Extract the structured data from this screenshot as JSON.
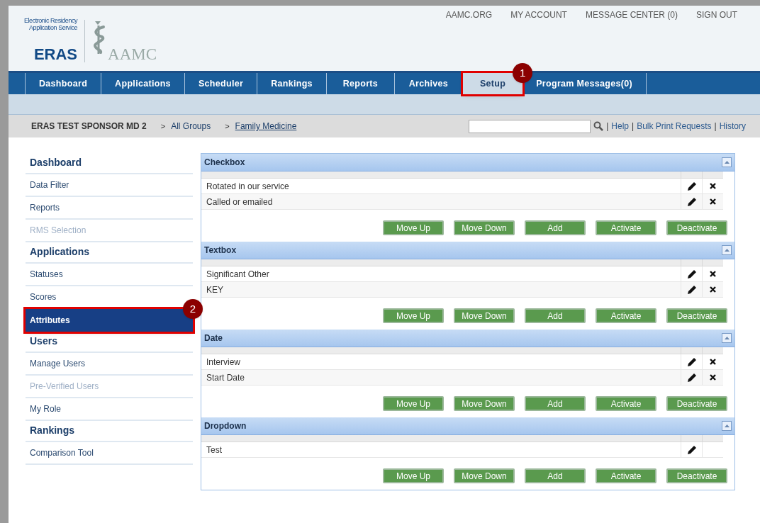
{
  "logo": {
    "tagline_1": "Electronic Residency",
    "tagline_2": "Application Service",
    "wordmark": "ERAS",
    "partner": "AAMC"
  },
  "top_links": [
    "AAMC.ORG",
    "MY ACCOUNT",
    "MESSAGE CENTER (0)",
    "SIGN OUT"
  ],
  "nav_tabs": [
    {
      "label": "Dashboard",
      "selected": false
    },
    {
      "label": "Applications",
      "selected": false
    },
    {
      "label": "Scheduler",
      "selected": false
    },
    {
      "label": "Rankings",
      "selected": false
    },
    {
      "label": "Reports",
      "selected": false
    },
    {
      "label": "Archives",
      "selected": false
    },
    {
      "label": "Setup",
      "selected": true,
      "callout": "1"
    },
    {
      "label": "Program Messages(0)",
      "selected": false
    }
  ],
  "breadcrumb": {
    "sponsor": "ERAS TEST SPONSOR MD 2",
    "crumbs": [
      {
        "arrow": ">",
        "label": "All Groups",
        "underlined": false
      },
      {
        "arrow": ">",
        "label": "Family Medicine",
        "underlined": true
      }
    ]
  },
  "utility": {
    "separator": "|",
    "links": [
      "Help",
      "Bulk Print Requests",
      "History"
    ]
  },
  "sidebar": [
    {
      "heading": "Dashboard",
      "items": [
        {
          "label": "Data Filter",
          "selected": false,
          "disabled": false
        },
        {
          "label": "Reports",
          "selected": false,
          "disabled": false
        },
        {
          "label": "RMS Selection",
          "selected": false,
          "disabled": true
        }
      ]
    },
    {
      "heading": "Applications",
      "items": [
        {
          "label": "Statuses",
          "selected": false,
          "disabled": false
        },
        {
          "label": "Scores",
          "selected": false,
          "disabled": false
        },
        {
          "label": "Attributes",
          "selected": true,
          "disabled": false,
          "callout": "2"
        }
      ]
    },
    {
      "heading": "Users",
      "items": [
        {
          "label": "Manage Users",
          "selected": false,
          "disabled": false
        },
        {
          "label": "Pre-Verified Users",
          "selected": false,
          "disabled": true
        },
        {
          "label": "My Role",
          "selected": false,
          "disabled": false
        }
      ]
    },
    {
      "heading": "Rankings",
      "items": [
        {
          "label": "Comparison Tool",
          "selected": false,
          "disabled": false
        }
      ]
    }
  ],
  "panels": [
    {
      "title": "Checkbox",
      "rows": [
        {
          "name": "Rotated in our service",
          "deletable": true
        },
        {
          "name": "Called or emailed",
          "deletable": true
        }
      ],
      "buttons": [
        "Move Up",
        "Move Down",
        "Add",
        "Activate",
        "Deactivate"
      ]
    },
    {
      "title": "Textbox",
      "rows": [
        {
          "name": "Significant Other",
          "deletable": true
        },
        {
          "name": "KEY",
          "deletable": true
        }
      ],
      "buttons": [
        "Move Up",
        "Move Down",
        "Add",
        "Activate",
        "Deactivate"
      ]
    },
    {
      "title": "Date",
      "rows": [
        {
          "name": "Interview",
          "deletable": true
        },
        {
          "name": "Start Date",
          "deletable": true
        }
      ],
      "buttons": [
        "Move Up",
        "Move Down",
        "Add",
        "Activate",
        "Deactivate"
      ]
    },
    {
      "title": "Dropdown",
      "rows": [
        {
          "name": "Test",
          "deletable": false
        }
      ],
      "buttons": [
        "Move Up",
        "Move Down",
        "Add",
        "Activate",
        "Deactivate"
      ]
    }
  ]
}
